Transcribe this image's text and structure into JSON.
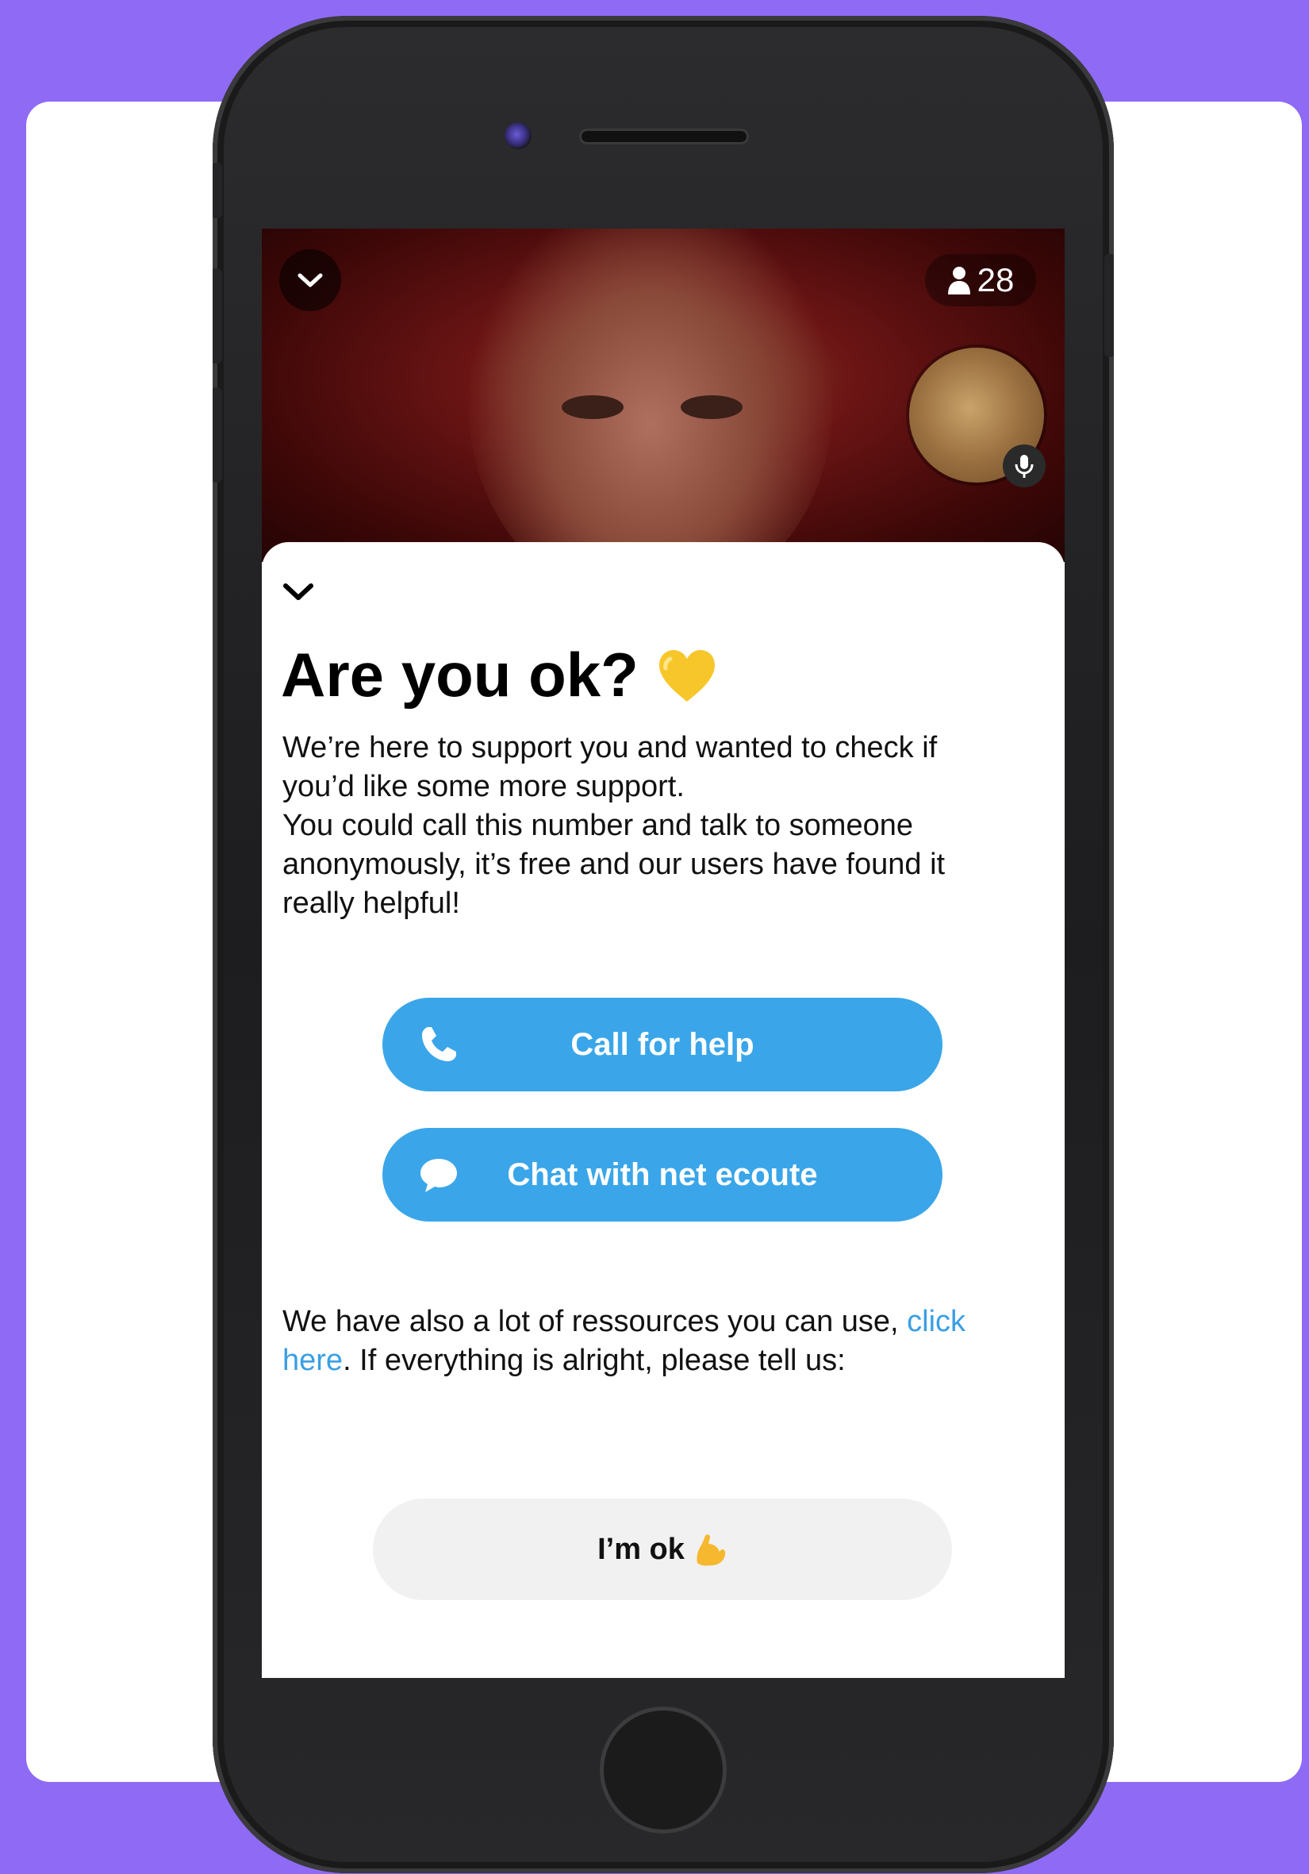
{
  "app": {
    "viewer_count": "28"
  },
  "dialog": {
    "title": "Are you ok?",
    "intro": "We’re here to support you and wanted to check if you’d like some more support.",
    "call_info": "You could call this number and talk to someone anonymously, it’s free and our users have found it really helpful!",
    "call_button_label": "Call for help",
    "chat_button_label": "Chat with net ecoute",
    "resources_text_before": "We have also a lot of ressources you can use, ",
    "resources_link_label": "click here",
    "resources_text_after": ". If everything is alright, please tell us:",
    "ok_button_label": "I’m ok"
  },
  "icons": {
    "title_icon": "yellow-heart-icon",
    "ok_icon": "flexed-bicep-icon",
    "call_icon": "phone-icon",
    "chat_icon": "speech-bubble-icon"
  },
  "colors": {
    "background": "#8f6bf5",
    "button_primary": "#3aa6e9",
    "link": "#3a9fe4",
    "heart": "#f7c62b"
  }
}
